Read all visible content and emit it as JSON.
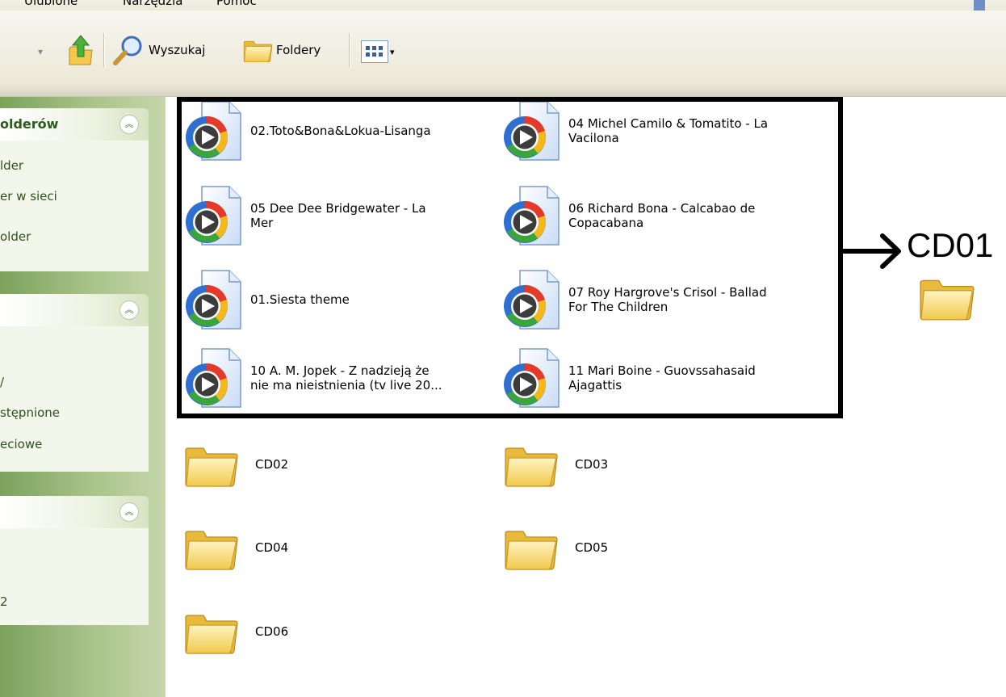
{
  "menu": {
    "items": [
      "Ulubione",
      "Narzędzia",
      "Pomoc"
    ]
  },
  "toolbar": {
    "search_label": "Wyszukaj",
    "folders_label": "Foldery"
  },
  "left_pane": {
    "panel1": {
      "title": "olderów",
      "links": [
        "lder",
        "er w sieci",
        "older"
      ]
    },
    "panel2": {
      "links": [
        "/",
        "stępnione",
        "eciowe"
      ]
    },
    "panel3": {
      "links": [
        "2"
      ]
    }
  },
  "files": [
    {
      "name": "02.Toto&Bona&Lokua-Lisanga"
    },
    {
      "name": "04 Michel Camilo & Tomatito - La\nVacilona"
    },
    {
      "name": "05 Dee Dee Bridgewater - La\nMer"
    },
    {
      "name": "06 Richard Bona - Calcabao de\nCopacabana"
    },
    {
      "name": "01.Siesta theme"
    },
    {
      "name": "07 Roy Hargrove's Crisol - Ballad\nFor The Children"
    },
    {
      "name": "10 A. M. Jopek - Z nadzieją że\nnie ma nieistnienia (tv live 20..."
    },
    {
      "name": "11 Mari Boine - Guovssahasaid\nAjagattis"
    }
  ],
  "folders": [
    {
      "name": "CD02"
    },
    {
      "name": "CD03"
    },
    {
      "name": "CD04"
    },
    {
      "name": "CD05"
    },
    {
      "name": "CD06"
    }
  ],
  "annotation": {
    "label": "CD01"
  },
  "colors": {
    "task_pane_green": "#7ba25c",
    "task_title": "#2b5b1a",
    "highlight_border": "#000000",
    "folder_yellow": "#f5d879"
  }
}
